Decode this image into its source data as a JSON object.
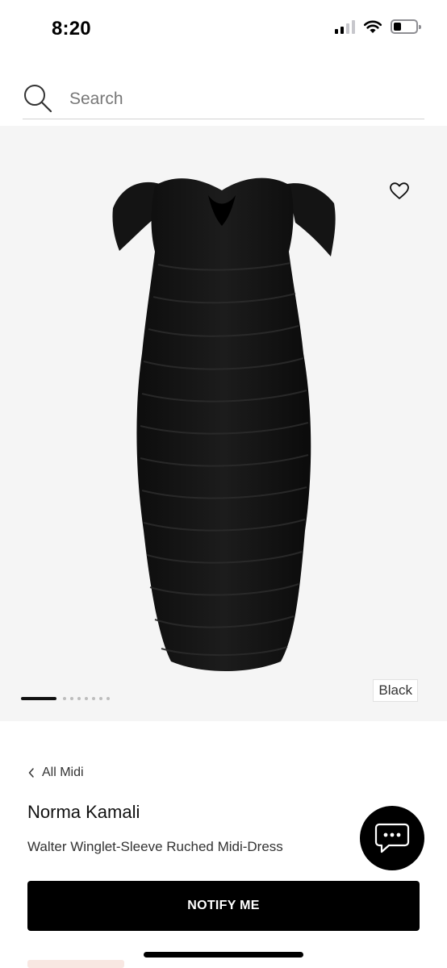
{
  "status_bar": {
    "time": "8:20",
    "icons": [
      "cellular-signal-icon",
      "wifi-icon",
      "battery-icon"
    ]
  },
  "search": {
    "placeholder": "Search",
    "icon": "search-icon"
  },
  "gallery": {
    "image_alt": "Walter Winglet-Sleeve Ruched Midi-Dress",
    "color_label": "Black",
    "pager": {
      "current": 1,
      "total": 8
    },
    "favorite_icon": "heart-icon"
  },
  "product": {
    "breadcrumb_label": "All Midi",
    "brand": "Norma Kamali",
    "name": "Walter Winglet-Sleeve Ruched Midi-Dress"
  },
  "actions": {
    "notify_label": "NOTIFY ME",
    "chat_icon": "chat-icon"
  },
  "colors": {
    "primary": "#000000",
    "gallery_background": "#f5f5f5"
  }
}
